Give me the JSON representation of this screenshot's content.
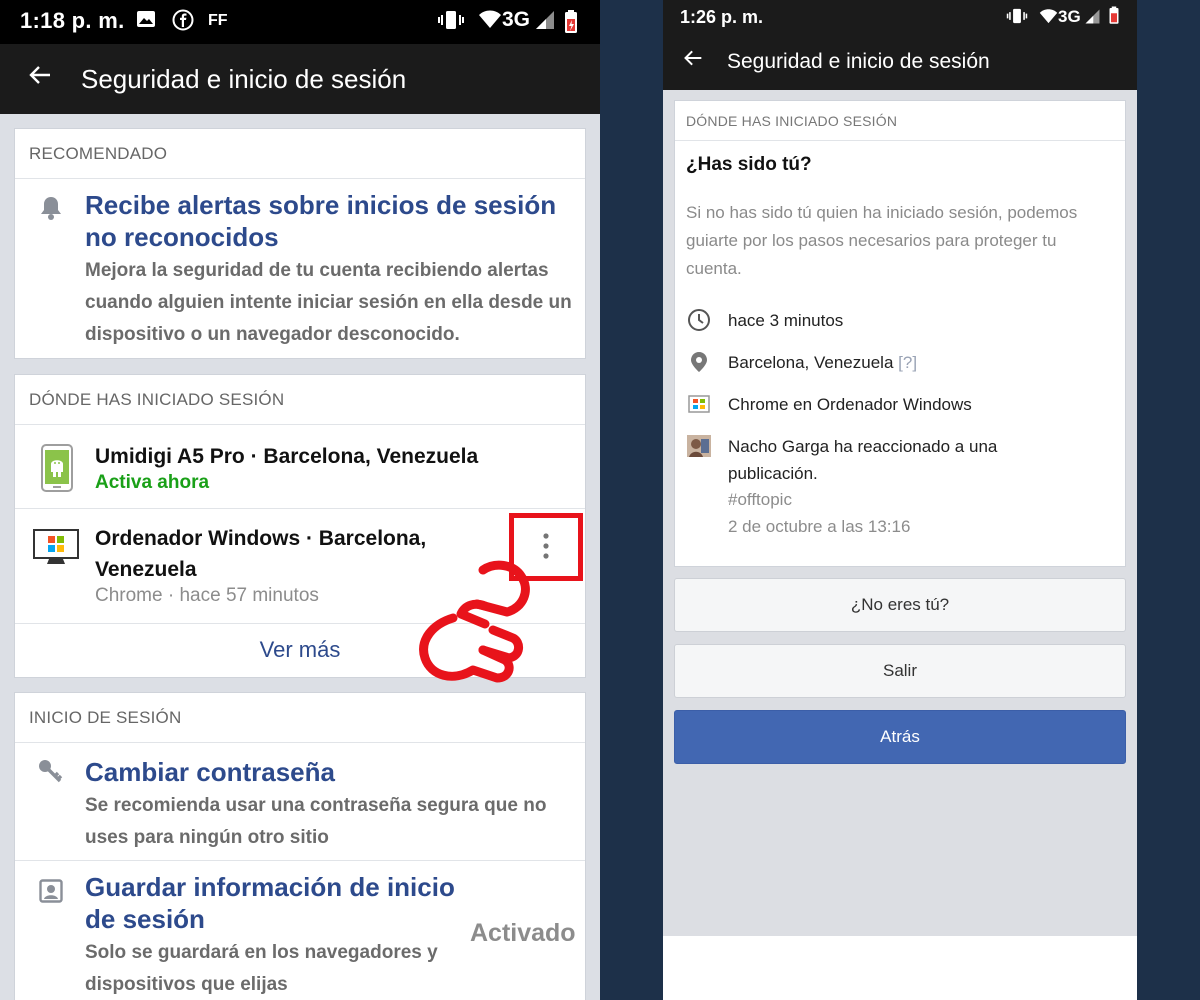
{
  "left": {
    "status": {
      "time": "1:18 p. m.",
      "carrier_icons": "FF",
      "network": "3G"
    },
    "header": {
      "title": "Seguridad e inicio de sesión"
    },
    "recommended": {
      "heading": "RECOMENDADO",
      "alert_title": "Recibe alertas sobre inicios de sesión no reconocidos",
      "alert_desc": "Mejora la seguridad de tu cuenta recibiendo alertas cuando alguien intente iniciar sesión en ella desde un dispositivo o un navegador desconocido."
    },
    "where": {
      "heading": "DÓNDE HAS INICIADO SESIÓN",
      "devices": [
        {
          "name": "Umidigi A5 Pro · Barcelona, Venezuela",
          "sub": "Activa ahora",
          "icon": "android-phone-icon"
        },
        {
          "name": "Ordenador Windows · Barcelona, Venezuela",
          "sub": "Chrome · hace 57 minutos",
          "icon": "windows-desktop-icon"
        }
      ],
      "see_more": "Ver más"
    },
    "login": {
      "heading": "INICIO DE SESIÓN",
      "change_pw_title": "Cambiar contraseña",
      "change_pw_desc": "Se recomienda usar una contraseña segura que no uses para ningún otro sitio",
      "save_title": "Guardar información de inicio de sesión",
      "save_desc": "Solo se guardará en los navegadores y dispositivos que elijas",
      "save_status": "Activado"
    }
  },
  "right": {
    "status": {
      "time": "1:26 p. m.",
      "network": "3G"
    },
    "header": {
      "title": "Seguridad e inicio de sesión"
    },
    "card": {
      "heading": "DÓNDE HAS INICIADO SESIÓN",
      "question": "¿Has sido tú?",
      "paragraph": "Si no has sido tú quien ha iniciado sesión, podemos guiarte por los pasos necesarios para proteger tu cuenta.",
      "time": "hace 3 minutos",
      "location": "Barcelona, Venezuela",
      "location_help": "[?]",
      "browser": "Chrome en Ordenador Windows",
      "activity": "Nacho Garga ha reaccionado a una publicación.",
      "activity_tag": "#offtopic",
      "activity_date": "2 de octubre a las 13:16"
    },
    "buttons": {
      "not_you": "¿No eres tú?",
      "logout": "Salir",
      "back": "Atrás"
    }
  },
  "colors": {
    "link_blue": "#2d4a8c",
    "active_green": "#1aa018",
    "fb_blue": "#4267b2",
    "highlight_red": "#e8131b"
  }
}
